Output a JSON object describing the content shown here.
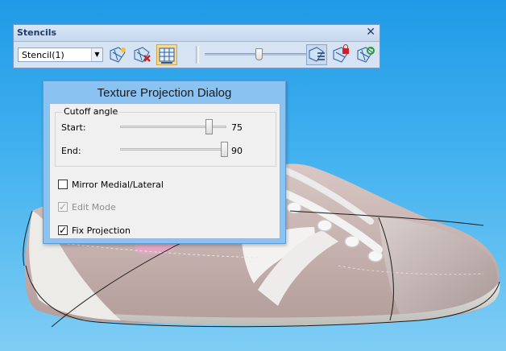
{
  "toolbar": {
    "title": "Stencils",
    "close": "✕",
    "stencil_select": {
      "value": "Stencil(1)"
    },
    "opacity_slider": {
      "value_fraction": 0.5
    }
  },
  "dialog": {
    "title": "Texture Projection Dialog",
    "cutoff": {
      "legend": "Cutoff angle",
      "start_label": "Start:",
      "start_value": "75",
      "start_fraction": 0.83,
      "end_label": "End:",
      "end_value": "90",
      "end_fraction": 0.98
    },
    "mirror": {
      "label": "Mirror Medial/Lateral",
      "checked": false
    },
    "edit_mode": {
      "label": "Edit Mode",
      "checked": true,
      "disabled": true
    },
    "fix_projection": {
      "label": "Fix Projection",
      "checked": true
    }
  },
  "colors": {
    "background": "#2a9fe8",
    "dialog_frame": "#8ac3f1",
    "toolbar": "#d6e3f3",
    "active_button": "#f6dc8c"
  }
}
